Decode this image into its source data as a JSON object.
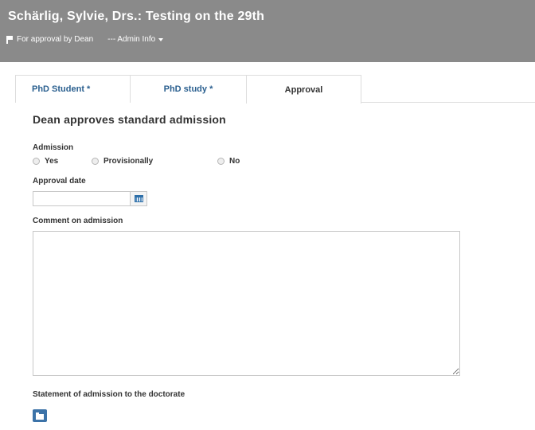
{
  "header": {
    "title": "Schärlig, Sylvie, Drs.: Testing on the 29th",
    "status_label": "For approval by Dean",
    "admin_menu_label": "--- Admin Info"
  },
  "tabs": [
    {
      "label": "PhD Student *",
      "active": false
    },
    {
      "label": "PhD study *",
      "active": false
    },
    {
      "label": "Approval",
      "active": true
    }
  ],
  "main": {
    "section_title": "Dean approves standard admission",
    "admission": {
      "label": "Admission",
      "options": [
        "Yes",
        "Provisionally",
        "No"
      ]
    },
    "approval_date": {
      "label": "Approval date",
      "value": ""
    },
    "comment": {
      "label": "Comment on admission",
      "value": ""
    },
    "statement": {
      "label": "Statement of admission to the doctorate"
    }
  },
  "colors": {
    "header_bg": "#8a8a8a",
    "tab_text": "#2a5f8f",
    "accent": "#3c73a8"
  },
  "icons": [
    "flag-icon",
    "caret-down-icon",
    "calendar-icon",
    "folder-icon"
  ]
}
